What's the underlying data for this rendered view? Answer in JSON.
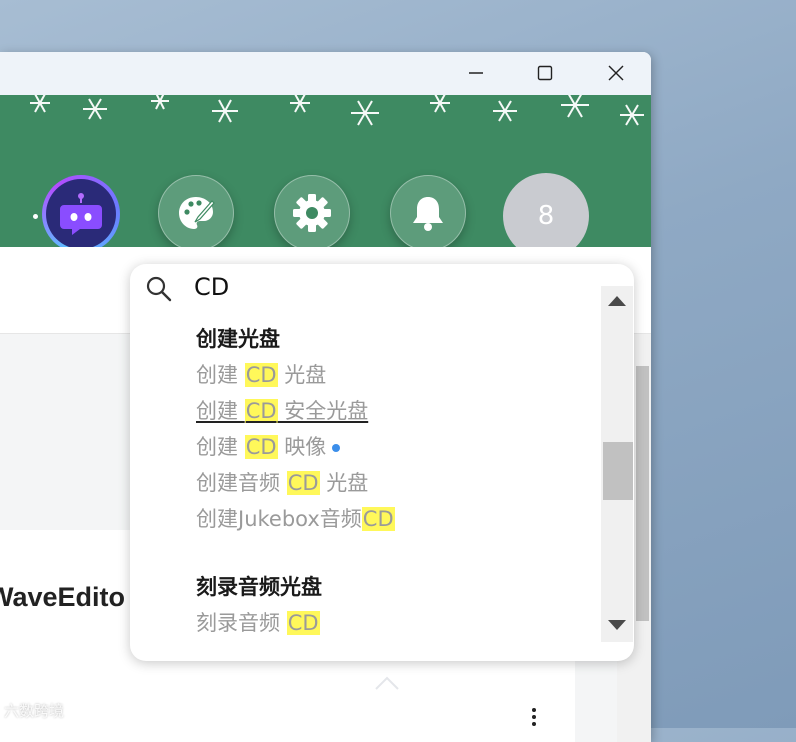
{
  "window": {
    "controls": {
      "minimize_icon": "minimize-icon",
      "maximize_icon": "maximize-icon",
      "close_icon": "close-icon"
    }
  },
  "banner": {
    "background_color": "#3e8a62",
    "buttons": [
      {
        "name": "assistant-avatar-button",
        "icon": "robot-chat-icon"
      },
      {
        "name": "palette-button",
        "icon": "palette-icon"
      },
      {
        "name": "settings-button",
        "icon": "gear-icon"
      },
      {
        "name": "notifications-button",
        "icon": "bell-icon"
      }
    ],
    "count_badge": "8"
  },
  "main": {
    "card_title": "WaveEdito"
  },
  "search": {
    "value": "CD",
    "icon": "search-icon",
    "groups": [
      {
        "title": "创建光盘",
        "items": [
          {
            "before": "创建 ",
            "highlight": "CD",
            "after": " 光盘"
          },
          {
            "before": "创建 ",
            "highlight": "CD",
            "after": " 安全光盘"
          },
          {
            "before": "创建 ",
            "highlight": "CD",
            "after": " 映像"
          },
          {
            "before": "创建音频 ",
            "highlight": "CD",
            "after": " 光盘"
          },
          {
            "before": "创建Jukebox音频",
            "highlight": "CD",
            "after": ""
          }
        ]
      },
      {
        "title": "刻录音频光盘",
        "items": [
          {
            "before": "刻录音频 ",
            "highlight": "CD",
            "after": ""
          }
        ]
      }
    ],
    "highlight_color": "#fff85a"
  },
  "watermark": "六数跨境"
}
